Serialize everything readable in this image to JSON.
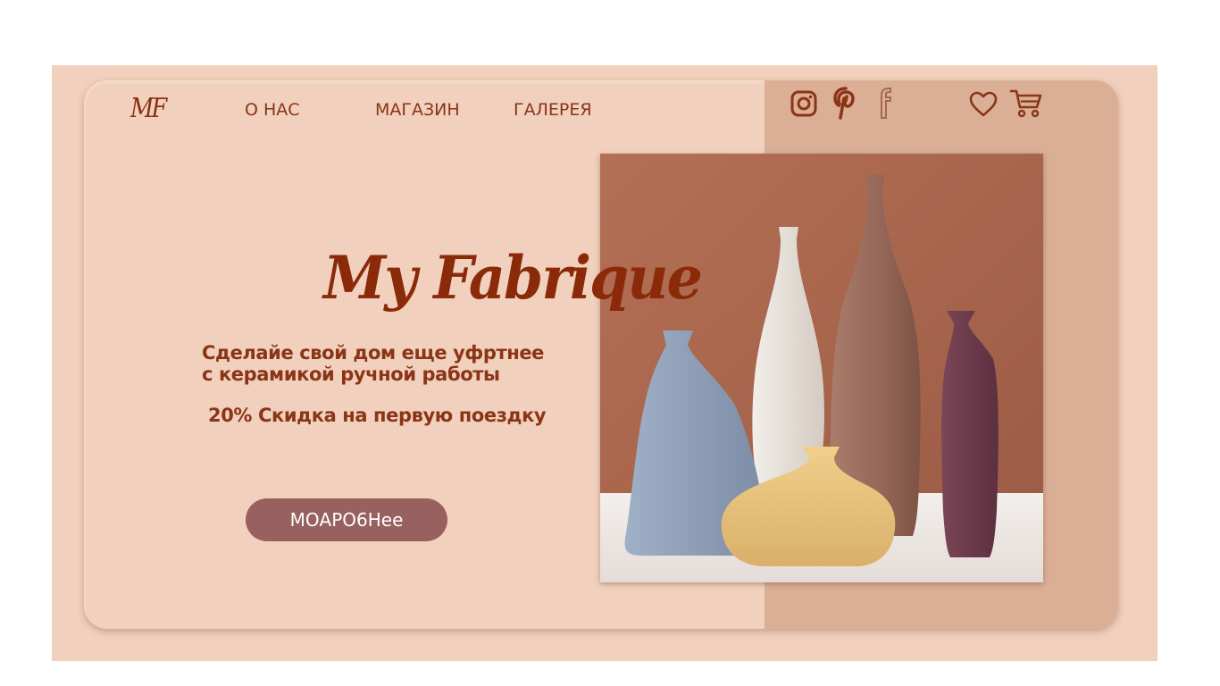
{
  "brand": {
    "logo": "MF"
  },
  "nav": {
    "items": [
      {
        "label": "О НАС"
      },
      {
        "label": "МАГАЗИН"
      },
      {
        "label": "ГАЛЕРЕЯ"
      }
    ]
  },
  "social_icons": [
    "instagram-icon",
    "pinterest-icon",
    "facebook-icon"
  ],
  "header_actions": [
    "heart-icon",
    "cart-icon"
  ],
  "hero": {
    "title": "My Fabrique",
    "tagline_line1": "Сделайе свой дом еще уфртнее",
    "tagline_line2": "с керамикой ручной работы",
    "discount": "20% Скидка на первую поездку",
    "cta_label": "МОАРО6Нее"
  },
  "colors": {
    "page_bg": "#f1d0bd",
    "panel_bg": "#dbaf96",
    "brand_text": "#8b3416",
    "button_bg": "#98605f",
    "button_text": "#ffffff"
  }
}
